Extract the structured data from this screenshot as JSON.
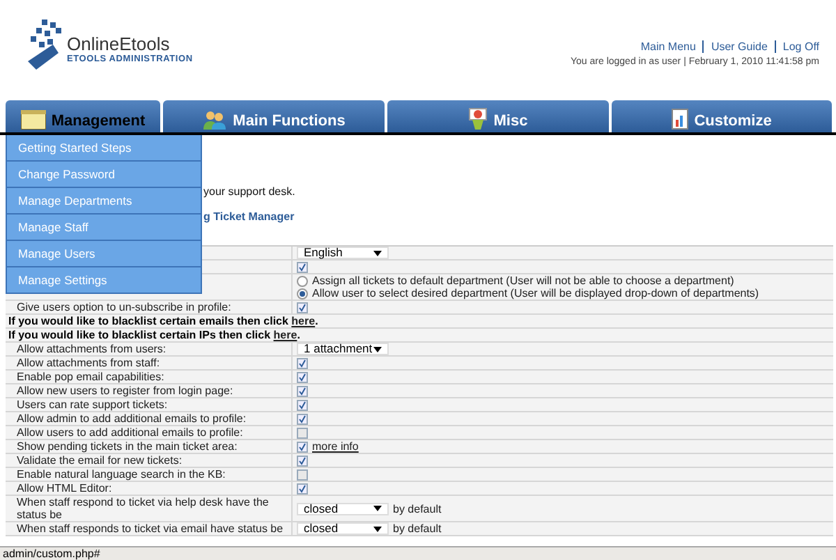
{
  "header": {
    "logo_title": "OnlineEtools",
    "logo_subtitle": "ETOOLS ADMINISTRATION",
    "links": [
      "Main Menu",
      "User Guide",
      "Log Off"
    ],
    "status": "You are logged in as user | February 1, 2010 11:41:58 pm"
  },
  "tabs": [
    {
      "label": "Management",
      "selected": true
    },
    {
      "label": "Main Functions",
      "selected": false
    },
    {
      "label": "Misc",
      "selected": false
    },
    {
      "label": "Customize",
      "selected": false
    }
  ],
  "menu": [
    "Getting Started Steps",
    "Change Password",
    "Manage Departments",
    "Manage Staff",
    "Manage Users",
    "Manage Settings"
  ],
  "intro": [
    "your support desk.",
    "g Ticket Manager"
  ],
  "rows": [
    {
      "kind": "select",
      "value": "English"
    },
    {
      "kind": "checkbox",
      "checked": true
    },
    {
      "kind": "radios",
      "options": [
        {
          "label": "Assign all tickets to default department (User will not be able to choose a department)",
          "selected": false
        },
        {
          "label": "Allow user to select desired department (User will be displayed drop-down of departments)",
          "selected": true
        }
      ]
    },
    {
      "kind": "checkbox",
      "label": "Give users option to un-subscribe in profile:",
      "checked": true
    },
    {
      "kind": "notice",
      "text": "If you would like to blacklist certain emails then click ",
      "link": "here",
      "tail": "."
    },
    {
      "kind": "notice",
      "text": "If you would like to blacklist certain IPs then click ",
      "link": "here",
      "tail": "."
    },
    {
      "kind": "select",
      "label": "Allow attachments from users:",
      "value": "1 attachment"
    },
    {
      "kind": "checkbox",
      "label": "Allow attachments from staff:",
      "checked": true
    },
    {
      "kind": "checkbox",
      "label": "Enable pop email capabilities:",
      "checked": true
    },
    {
      "kind": "checkbox",
      "label": "Allow new users to register from login page:",
      "checked": true
    },
    {
      "kind": "checkbox",
      "label": "Users can rate support tickets:",
      "checked": true
    },
    {
      "kind": "checkbox",
      "label": "Allow admin to add additional emails to profile:",
      "checked": true
    },
    {
      "kind": "checkbox",
      "label": "Allow users to add additional emails to profile:",
      "checked": false
    },
    {
      "kind": "checkbox",
      "label": "Show pending tickets in the main ticket area:",
      "checked": true,
      "link": "more info"
    },
    {
      "kind": "checkbox",
      "label": "Validate the email for new tickets:",
      "checked": true
    },
    {
      "kind": "checkbox",
      "label": "Enable natural language search in the KB:",
      "checked": false
    },
    {
      "kind": "checkbox",
      "label": "Allow HTML Editor:",
      "checked": true
    },
    {
      "kind": "select",
      "label": "When staff respond to ticket via help desk have the status be",
      "value": "closed",
      "suffix": "by default"
    },
    {
      "kind": "select",
      "label": "When staff responds to ticket via email have status be",
      "value": "closed",
      "suffix": "by default"
    }
  ],
  "status_bar": "admin/custom.php#"
}
